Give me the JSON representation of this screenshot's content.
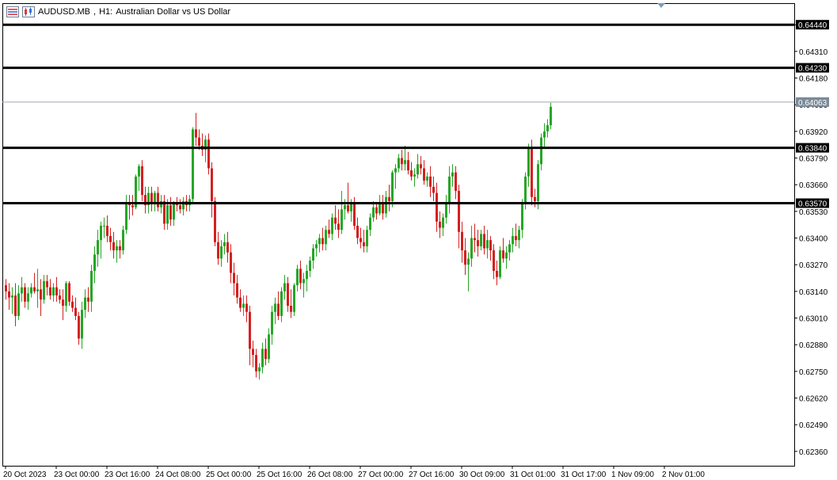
{
  "header": {
    "symbol": "AUDUSD.MB",
    "timeframe": "H1:",
    "description": "Australian Dollar vs US Dollar"
  },
  "colors": {
    "bull": "#26a626",
    "bear": "#d42020",
    "line": "#000000",
    "current_price_line": "#a0a8b0",
    "current_price_bg": "#7a8a99",
    "grid": "none"
  },
  "chart_data": {
    "type": "candlestick",
    "title": "",
    "y_ticks": [
      "0.64440",
      "0.64310",
      "0.64180",
      "0.64050",
      "0.63920",
      "0.63790",
      "0.63660",
      "0.63530",
      "0.63400",
      "0.63270",
      "0.63140",
      "0.63010",
      "0.62880",
      "0.62750",
      "0.62620",
      "0.62490",
      "0.62360"
    ],
    "y_tick_values": [
      0.6444,
      0.6431,
      0.6418,
      0.6405,
      0.6392,
      0.6379,
      0.6366,
      0.6353,
      0.634,
      0.6327,
      0.6314,
      0.6301,
      0.6288,
      0.6275,
      0.6262,
      0.6249,
      0.6236
    ],
    "x_ticks": [
      "20 Oct 2023",
      "23 Oct 00:00",
      "23 Oct 16:00",
      "24 Oct 08:00",
      "25 Oct 00:00",
      "25 Oct 16:00",
      "26 Oct 08:00",
      "27 Oct 00:00",
      "27 Oct 16:00",
      "30 Oct 09:00",
      "31 Oct 01:00",
      "31 Oct 17:00",
      "1 Nov 09:00",
      "2 Nov 01:00"
    ],
    "x_tick_bar_index": [
      0,
      16,
      32,
      48,
      64,
      80,
      96,
      112,
      128,
      144,
      160,
      176,
      192,
      208
    ],
    "ylim": [
      0.6229,
      0.64545
    ],
    "horizontal_levels": [
      {
        "label": "0.64440",
        "value": 0.6444
      },
      {
        "label": "0.64230",
        "value": 0.6423
      },
      {
        "label": "0.63840",
        "value": 0.6384
      },
      {
        "label": "0.63570",
        "value": 0.6357
      }
    ],
    "current_price": {
      "label": "0.64063",
      "value": 0.64063
    },
    "candles": [
      [
        0.6317,
        0.632,
        0.631,
        0.6314
      ],
      [
        0.6314,
        0.6318,
        0.6305,
        0.6311
      ],
      [
        0.6311,
        0.6316,
        0.6303,
        0.6312
      ],
      [
        0.6312,
        0.6318,
        0.6297,
        0.6302
      ],
      [
        0.6302,
        0.6317,
        0.63,
        0.6313
      ],
      [
        0.6313,
        0.6321,
        0.6309,
        0.6316
      ],
      [
        0.6316,
        0.6318,
        0.6306,
        0.6309
      ],
      [
        0.6309,
        0.6316,
        0.6305,
        0.6313
      ],
      [
        0.6313,
        0.6318,
        0.6311,
        0.6316
      ],
      [
        0.6316,
        0.6323,
        0.6313,
        0.6314
      ],
      [
        0.6314,
        0.6325,
        0.6306,
        0.6315
      ],
      [
        0.6315,
        0.632,
        0.6302,
        0.631
      ],
      [
        0.631,
        0.6322,
        0.6308,
        0.6319
      ],
      [
        0.6319,
        0.6322,
        0.6312,
        0.6316
      ],
      [
        0.6316,
        0.632,
        0.631,
        0.6312
      ],
      [
        0.6312,
        0.6318,
        0.6309,
        0.6316
      ],
      [
        0.6316,
        0.6321,
        0.6309,
        0.6312
      ],
      [
        0.6312,
        0.6315,
        0.6308,
        0.631
      ],
      [
        0.631,
        0.6315,
        0.63,
        0.6307
      ],
      [
        0.6307,
        0.6319,
        0.6304,
        0.6318
      ],
      [
        0.6318,
        0.6319,
        0.6307,
        0.6309
      ],
      [
        0.6309,
        0.6312,
        0.6304,
        0.6306
      ],
      [
        0.6306,
        0.6311,
        0.63,
        0.6302
      ],
      [
        0.6302,
        0.6304,
        0.6288,
        0.6291
      ],
      [
        0.6291,
        0.6309,
        0.6286,
        0.6305
      ],
      [
        0.6305,
        0.6315,
        0.6301,
        0.6311
      ],
      [
        0.6311,
        0.6316,
        0.6304,
        0.6309
      ],
      [
        0.6309,
        0.6327,
        0.6304,
        0.6324
      ],
      [
        0.6324,
        0.6336,
        0.6318,
        0.6332
      ],
      [
        0.6332,
        0.6344,
        0.6326,
        0.6339
      ],
      [
        0.6339,
        0.6348,
        0.633,
        0.6346
      ],
      [
        0.6346,
        0.635,
        0.634,
        0.6346
      ],
      [
        0.6346,
        0.6351,
        0.6338,
        0.6341
      ],
      [
        0.6341,
        0.6345,
        0.6334,
        0.6338
      ],
      [
        0.6338,
        0.6343,
        0.633,
        0.6334
      ],
      [
        0.6334,
        0.6339,
        0.6328,
        0.6336
      ],
      [
        0.6336,
        0.6339,
        0.633,
        0.6334
      ],
      [
        0.6334,
        0.6346,
        0.6332,
        0.6344
      ],
      [
        0.6344,
        0.6361,
        0.6342,
        0.6357
      ],
      [
        0.6357,
        0.6361,
        0.6349,
        0.6356
      ],
      [
        0.6356,
        0.6361,
        0.6351,
        0.6355
      ],
      [
        0.6355,
        0.6371,
        0.6354,
        0.637
      ],
      [
        0.637,
        0.6376,
        0.6363,
        0.6375
      ],
      [
        0.6375,
        0.6378,
        0.6358,
        0.6361
      ],
      [
        0.6361,
        0.6365,
        0.6352,
        0.6356
      ],
      [
        0.6356,
        0.6365,
        0.6352,
        0.6362
      ],
      [
        0.6362,
        0.6365,
        0.6353,
        0.6357
      ],
      [
        0.6357,
        0.6363,
        0.6353,
        0.6362
      ],
      [
        0.6362,
        0.6365,
        0.6353,
        0.6355
      ],
      [
        0.6355,
        0.6361,
        0.6352,
        0.6358
      ],
      [
        0.6358,
        0.6361,
        0.6344,
        0.6347
      ],
      [
        0.6347,
        0.6359,
        0.6344,
        0.6356
      ],
      [
        0.6356,
        0.636,
        0.6346,
        0.6349
      ],
      [
        0.6349,
        0.6358,
        0.6346,
        0.6357
      ],
      [
        0.6357,
        0.636,
        0.6353,
        0.6356
      ],
      [
        0.6356,
        0.6359,
        0.6352,
        0.6354
      ],
      [
        0.6354,
        0.636,
        0.6351,
        0.6358
      ],
      [
        0.6358,
        0.6361,
        0.6353,
        0.6356
      ],
      [
        0.6356,
        0.6361,
        0.6353,
        0.6359
      ],
      [
        0.6359,
        0.6394,
        0.6357,
        0.6393
      ],
      [
        0.6393,
        0.6401,
        0.6385,
        0.6389
      ],
      [
        0.6389,
        0.6393,
        0.6383,
        0.6385
      ],
      [
        0.6385,
        0.6391,
        0.638,
        0.6383
      ],
      [
        0.6383,
        0.639,
        0.6377,
        0.6388
      ],
      [
        0.6388,
        0.6391,
        0.6371,
        0.6374
      ],
      [
        0.6374,
        0.6377,
        0.635,
        0.6358
      ],
      [
        0.6358,
        0.636,
        0.6336,
        0.6338
      ],
      [
        0.6338,
        0.6343,
        0.6327,
        0.633
      ],
      [
        0.633,
        0.6339,
        0.6326,
        0.6336
      ],
      [
        0.6336,
        0.6342,
        0.6332,
        0.6338
      ],
      [
        0.6338,
        0.6343,
        0.6328,
        0.6333
      ],
      [
        0.6333,
        0.6337,
        0.6318,
        0.6323
      ],
      [
        0.6323,
        0.6328,
        0.6312,
        0.6318
      ],
      [
        0.6318,
        0.6322,
        0.6308,
        0.6311
      ],
      [
        0.6311,
        0.6315,
        0.6304,
        0.6306
      ],
      [
        0.6306,
        0.6312,
        0.6302,
        0.6308
      ],
      [
        0.6308,
        0.6312,
        0.6299,
        0.6304
      ],
      [
        0.6304,
        0.6307,
        0.6278,
        0.6286
      ],
      [
        0.6286,
        0.629,
        0.6277,
        0.6283
      ],
      [
        0.6283,
        0.6286,
        0.6272,
        0.6275
      ],
      [
        0.6275,
        0.6279,
        0.6271,
        0.6277
      ],
      [
        0.6277,
        0.6289,
        0.6274,
        0.6286
      ],
      [
        0.6286,
        0.6291,
        0.6278,
        0.6281
      ],
      [
        0.6281,
        0.6296,
        0.6279,
        0.6293
      ],
      [
        0.6293,
        0.6307,
        0.6288,
        0.6304
      ],
      [
        0.6304,
        0.6311,
        0.6298,
        0.6308
      ],
      [
        0.6308,
        0.6314,
        0.63,
        0.6302
      ],
      [
        0.6302,
        0.6316,
        0.6299,
        0.6314
      ],
      [
        0.6314,
        0.6322,
        0.631,
        0.6318
      ],
      [
        0.6318,
        0.6321,
        0.6304,
        0.6307
      ],
      [
        0.6307,
        0.6315,
        0.6301,
        0.6304
      ],
      [
        0.6304,
        0.6318,
        0.6302,
        0.6317
      ],
      [
        0.6317,
        0.6327,
        0.6314,
        0.6325
      ],
      [
        0.6325,
        0.6329,
        0.6315,
        0.6318
      ],
      [
        0.6318,
        0.6323,
        0.6311,
        0.632
      ],
      [
        0.632,
        0.6327,
        0.6314,
        0.6324
      ],
      [
        0.6324,
        0.6331,
        0.6321,
        0.6329
      ],
      [
        0.6329,
        0.6337,
        0.6325,
        0.6335
      ],
      [
        0.6335,
        0.6339,
        0.6331,
        0.6337
      ],
      [
        0.6337,
        0.6342,
        0.6333,
        0.634
      ],
      [
        0.634,
        0.6345,
        0.6334,
        0.6337
      ],
      [
        0.6337,
        0.6346,
        0.6334,
        0.6344
      ],
      [
        0.6344,
        0.6349,
        0.634,
        0.6342
      ],
      [
        0.6342,
        0.6352,
        0.6339,
        0.635
      ],
      [
        0.635,
        0.6356,
        0.6344,
        0.6347
      ],
      [
        0.6347,
        0.6354,
        0.634,
        0.6344
      ],
      [
        0.6344,
        0.6363,
        0.6342,
        0.6354
      ],
      [
        0.6354,
        0.6359,
        0.6349,
        0.6356
      ],
      [
        0.6356,
        0.6367,
        0.6352,
        0.6353
      ],
      [
        0.6353,
        0.6359,
        0.6348,
        0.6357
      ],
      [
        0.6357,
        0.636,
        0.6344,
        0.6346
      ],
      [
        0.6346,
        0.635,
        0.6337,
        0.634
      ],
      [
        0.634,
        0.6345,
        0.6335,
        0.6338
      ],
      [
        0.6338,
        0.6344,
        0.6333,
        0.6336
      ],
      [
        0.6336,
        0.6346,
        0.6333,
        0.6344
      ],
      [
        0.6344,
        0.6352,
        0.6341,
        0.635
      ],
      [
        0.635,
        0.6358,
        0.6348,
        0.6355
      ],
      [
        0.6355,
        0.6357,
        0.6349,
        0.6352
      ],
      [
        0.6352,
        0.6361,
        0.6351,
        0.6357
      ],
      [
        0.6357,
        0.6361,
        0.6349,
        0.6352
      ],
      [
        0.6352,
        0.6363,
        0.635,
        0.636
      ],
      [
        0.636,
        0.6366,
        0.6353,
        0.6358
      ],
      [
        0.6358,
        0.6373,
        0.6355,
        0.6372
      ],
      [
        0.6372,
        0.6376,
        0.6364,
        0.6374
      ],
      [
        0.6374,
        0.6381,
        0.6372,
        0.6379
      ],
      [
        0.6379,
        0.6383,
        0.6373,
        0.6376
      ],
      [
        0.6376,
        0.6385,
        0.6373,
        0.6378
      ],
      [
        0.6378,
        0.6382,
        0.6371,
        0.6373
      ],
      [
        0.6373,
        0.6377,
        0.6368,
        0.637
      ],
      [
        0.637,
        0.6374,
        0.6365,
        0.6371
      ],
      [
        0.6371,
        0.6381,
        0.6369,
        0.6376
      ],
      [
        0.6376,
        0.638,
        0.6371,
        0.6374
      ],
      [
        0.6374,
        0.6378,
        0.6366,
        0.6368
      ],
      [
        0.6368,
        0.6372,
        0.6365,
        0.637
      ],
      [
        0.637,
        0.6375,
        0.636,
        0.6365
      ],
      [
        0.6365,
        0.637,
        0.6358,
        0.6362
      ],
      [
        0.6362,
        0.6367,
        0.6343,
        0.6348
      ],
      [
        0.6348,
        0.6353,
        0.634,
        0.6345
      ],
      [
        0.6345,
        0.6352,
        0.6341,
        0.635
      ],
      [
        0.635,
        0.6361,
        0.6347,
        0.6357
      ],
      [
        0.6357,
        0.6375,
        0.6352,
        0.637
      ],
      [
        0.637,
        0.6376,
        0.6365,
        0.6372
      ],
      [
        0.6372,
        0.6375,
        0.6359,
        0.6363
      ],
      [
        0.6363,
        0.6366,
        0.6335,
        0.6343
      ],
      [
        0.6343,
        0.6348,
        0.6328,
        0.6334
      ],
      [
        0.6334,
        0.634,
        0.6322,
        0.6327
      ],
      [
        0.6327,
        0.6333,
        0.6314,
        0.633
      ],
      [
        0.633,
        0.6346,
        0.6326,
        0.634
      ],
      [
        0.634,
        0.6347,
        0.6333,
        0.6339
      ],
      [
        0.6339,
        0.6344,
        0.6331,
        0.6336
      ],
      [
        0.6336,
        0.6344,
        0.6334,
        0.6342
      ],
      [
        0.6342,
        0.6346,
        0.6332,
        0.6335
      ],
      [
        0.6335,
        0.6344,
        0.633,
        0.6339
      ],
      [
        0.6339,
        0.6341,
        0.6329,
        0.6334
      ],
      [
        0.6334,
        0.6337,
        0.632,
        0.6324
      ],
      [
        0.6324,
        0.6329,
        0.6317,
        0.6321
      ],
      [
        0.6321,
        0.6336,
        0.632,
        0.6334
      ],
      [
        0.6334,
        0.634,
        0.6328,
        0.633
      ],
      [
        0.633,
        0.6336,
        0.6325,
        0.6333
      ],
      [
        0.6333,
        0.6339,
        0.6329,
        0.6337
      ],
      [
        0.6337,
        0.6345,
        0.6333,
        0.6341
      ],
      [
        0.6341,
        0.6347,
        0.6336,
        0.6339
      ],
      [
        0.6339,
        0.6346,
        0.6335,
        0.6344
      ],
      [
        0.6344,
        0.6359,
        0.634,
        0.6357
      ],
      [
        0.6357,
        0.6372,
        0.6354,
        0.637
      ],
      [
        0.637,
        0.6386,
        0.6365,
        0.6384
      ],
      [
        0.6384,
        0.6388,
        0.6356,
        0.636
      ],
      [
        0.636,
        0.6364,
        0.6355,
        0.6358
      ],
      [
        0.6358,
        0.6378,
        0.6354,
        0.6376
      ],
      [
        0.6376,
        0.6391,
        0.6373,
        0.6389
      ],
      [
        0.6389,
        0.6396,
        0.6384,
        0.6392
      ],
      [
        0.6392,
        0.6398,
        0.6389,
        0.6395
      ],
      [
        0.6395,
        0.6406,
        0.6393,
        0.6404
      ]
    ]
  }
}
